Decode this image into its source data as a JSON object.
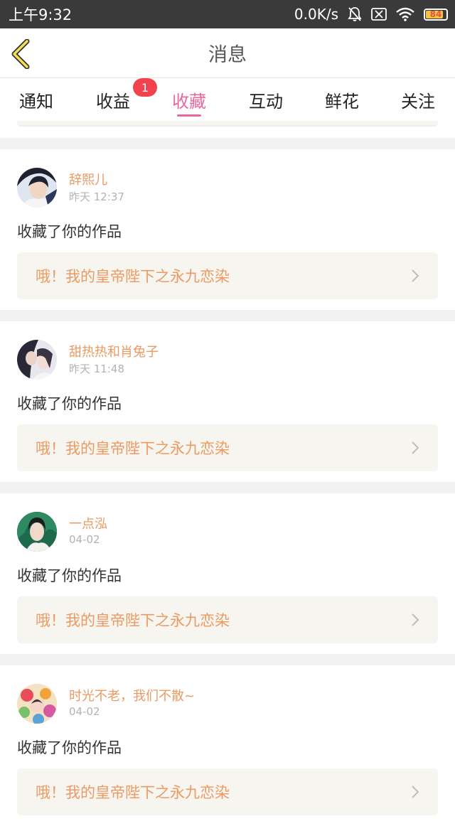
{
  "status_bar": {
    "time": "上午9:32",
    "network_speed": "0.0K/s",
    "battery": "84",
    "icons": [
      "mute-icon",
      "sim-icon",
      "wifi-icon",
      "battery-icon"
    ]
  },
  "header": {
    "back_icon": "back-chevron-icon",
    "title": "消息"
  },
  "tabs": [
    {
      "label": "通知",
      "active": false
    },
    {
      "label": "收益",
      "active": false,
      "badge": "1"
    },
    {
      "label": "收藏",
      "active": true
    },
    {
      "label": "互动",
      "active": false
    },
    {
      "label": "鲜花",
      "active": false
    },
    {
      "label": "关注",
      "active": false
    }
  ],
  "colors": {
    "accent_pink": "#e8679d",
    "name_orange": "#ec9a63",
    "badge_red": "#f2424e",
    "card_bg": "#f6f5ef"
  },
  "messages": [
    {
      "user": "辞熙儿",
      "time": "昨天 12:37",
      "action": "收藏了你的作品",
      "work": "哦！我的皇帝陛下之永九恋染"
    },
    {
      "user": "甜热热和肖兔子",
      "time": "昨天 11:48",
      "action": "收藏了你的作品",
      "work": "哦！我的皇帝陛下之永九恋染"
    },
    {
      "user": "一点泓",
      "time": "04-02",
      "action": "收藏了你的作品",
      "work": "哦！我的皇帝陛下之永九恋染"
    },
    {
      "user": "时光不老，我们不散~",
      "time": "04-02",
      "action": "收藏了你的作品",
      "work": "哦！我的皇帝陛下之永九恋染"
    }
  ]
}
